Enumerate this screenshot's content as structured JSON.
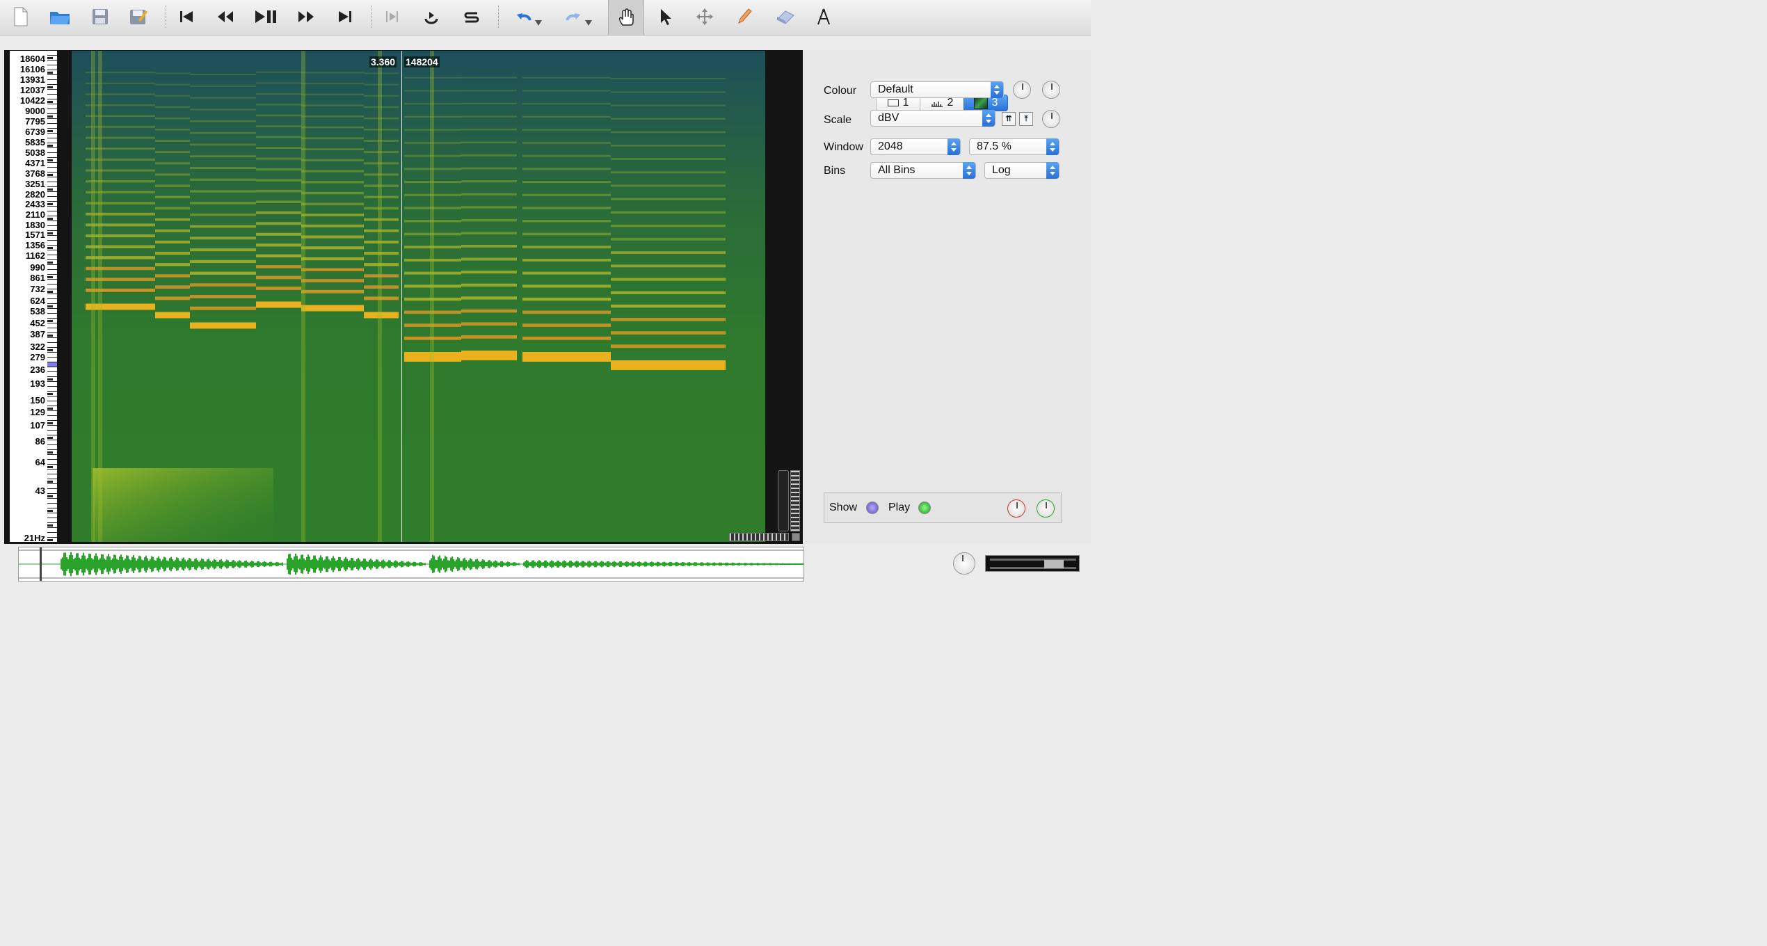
{
  "toolbar": {
    "icons": [
      "new-file-icon",
      "open-folder-icon",
      "save-icon",
      "save-as-icon",
      "rewind-start-icon",
      "rewind-icon",
      "play-pause-icon",
      "fast-forward-icon",
      "fast-forward-end-icon",
      "play-selection-icon",
      "loop-icon",
      "solo-icon",
      "undo-icon",
      "redo-icon",
      "navigate-hand-icon",
      "select-arrow-icon",
      "move-icon",
      "draw-pencil-icon",
      "erase-icon",
      "measure-icon"
    ]
  },
  "spectrogram": {
    "cursor_time": "3.360",
    "cursor_frame": "148204",
    "frequency_labels": [
      "18604",
      "16106",
      "13931",
      "12037",
      "10422",
      "9000",
      "7795",
      "6739",
      "5835",
      "5038",
      "4371",
      "3768",
      "3251",
      "2820",
      "2433",
      "2110",
      "1830",
      "1571",
      "1356",
      "1162",
      "990",
      "861",
      "732",
      "624",
      "538",
      "452",
      "387",
      "322",
      "279",
      "236",
      "193",
      "150",
      "129",
      "107",
      "86",
      "64",
      "43",
      "21Hz"
    ]
  },
  "panel": {
    "tabs": [
      {
        "label": "1",
        "icon": "waveform-pane-icon"
      },
      {
        "label": "2",
        "icon": "spectrum-pane-icon"
      },
      {
        "label": "3",
        "icon": "spectrogram-pane-icon"
      }
    ],
    "colour_label": "Colour",
    "colour_value": "Default",
    "scale_label": "Scale",
    "scale_value": "dBV",
    "window_label": "Window",
    "window_value": "2048",
    "overlap_value": "87.5 %",
    "bins_label": "Bins",
    "bins_value": "All Bins",
    "binscale_value": "Log",
    "show_label": "Show",
    "play_label": "Play"
  },
  "colors": {
    "accent": "#2a72db",
    "spectrogram_low": "#1f5a3a",
    "spectrogram_high": "#f0a020",
    "overview_wave": "#29a329"
  }
}
